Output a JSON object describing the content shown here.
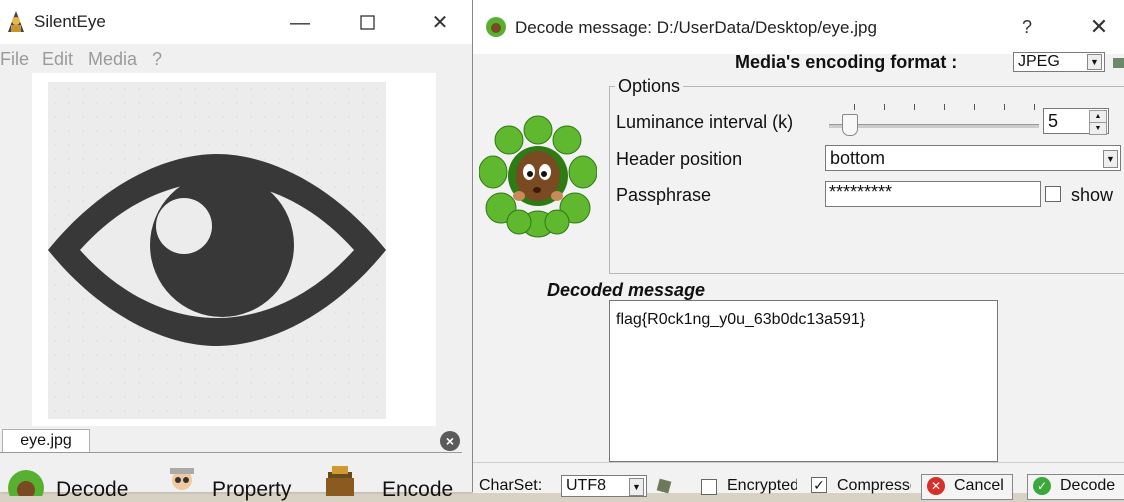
{
  "main_window": {
    "title": "SilentEye",
    "menu": [
      "File",
      "Edit",
      "Media",
      "?"
    ],
    "tab_label": "eye.jpg",
    "actions": {
      "decode_label": "Decode",
      "property_label": "Property",
      "encode_label": "Encode"
    }
  },
  "dialog": {
    "title": "Decode message: D:/UserData/Desktop/eye.jpg",
    "help": "?",
    "close": "✕",
    "encoding_format_label": "Media's encoding format :",
    "encoding_format_value": "JPEG",
    "options_title": "Options",
    "luminance_label": "Luminance interval (k)",
    "luminance_value": "5",
    "header_position_label": "Header position",
    "header_position_value": "bottom",
    "passphrase_label": "Passphrase",
    "passphrase_value": "*********",
    "show_label": "show",
    "decoded_message_label": "Decoded message",
    "decoded_message": "flag{R0ck1ng_y0u_63b0dc13a591}",
    "charset_label": "CharSet:",
    "charset_value": "UTF8",
    "encrypted_label": "Encrypted",
    "compressed_label": "Compressed",
    "cancel_label": "Cancel",
    "decode_label": "Decode"
  }
}
